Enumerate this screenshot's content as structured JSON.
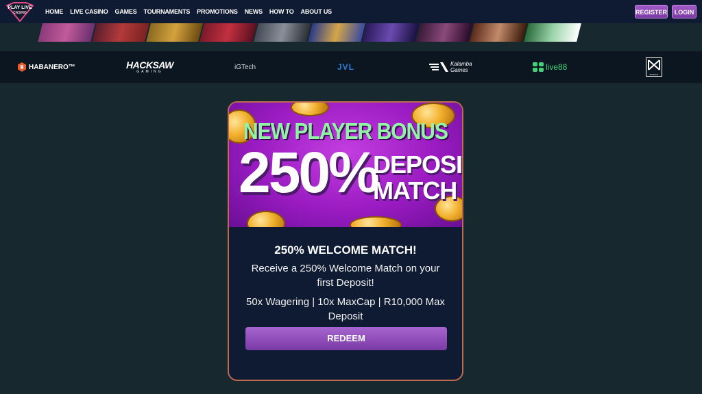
{
  "nav": {
    "logo": {
      "line1": "PLAY LIVE",
      "line2": "CASINO"
    },
    "items": [
      "HOME",
      "LIVE CASINO",
      "GAMES",
      "TOURNAMENTS",
      "PROMOTIONS",
      "NEWS",
      "HOW TO",
      "ABOUT US"
    ],
    "register_label": "REGISTER",
    "login_label": "LOGIN"
  },
  "providers": {
    "habanero": "HABANERO™",
    "hacksaw": {
      "line1": "HACKSAW",
      "line2": "GAMING"
    },
    "igtech": "iGTech",
    "jvl": "JVL",
    "kalamba": {
      "line1": "Kalamba",
      "line2": "Games"
    },
    "live88": "live88",
    "mascot": "MASCOT"
  },
  "promo": {
    "hero_line1": "NEW PLAYER BONUS",
    "hero_percent": "250%",
    "hero_line2a": "DEPOSIT",
    "hero_line2b": "MATCH",
    "title": "250% WELCOME MATCH!",
    "description": "Receive a 250% Welcome Match on your first Deposit!",
    "terms": "50x Wagering | 10x MaxCap | R10,000 Max Deposit",
    "redeem_label": "REDEEM"
  },
  "colors": {
    "page_bg": "#17292f",
    "nav_bg": "#0f1b33",
    "accent_purple": "#8e4bb8",
    "card_border": "#bd6a4e",
    "bonus_green": "#8ff5a2"
  }
}
